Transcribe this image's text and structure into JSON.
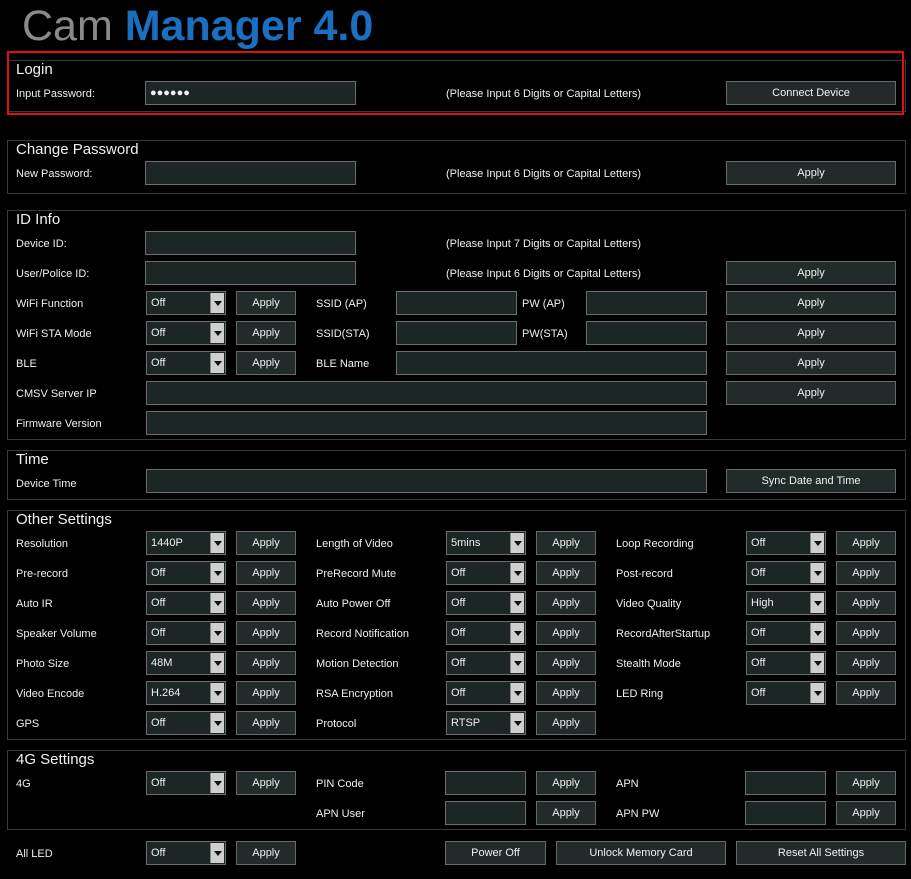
{
  "app": {
    "title_part1": "Cam ",
    "title_part2": "Manager 4.0"
  },
  "login": {
    "title": "Login",
    "password_label": "Input Password:",
    "password_value": "●●●●●●",
    "hint": "(Please Input 6 Digits or Capital Letters)",
    "connect_label": "Connect Device"
  },
  "change_password": {
    "title": "Change Password",
    "new_label": "New Password:",
    "hint": "(Please Input 6 Digits or Capital Letters)",
    "apply": "Apply"
  },
  "id_info": {
    "title": "ID Info",
    "device_id_label": "Device ID:",
    "device_id_hint": "(Please Input 7 Digits or Capital Letters)",
    "user_id_label": "User/Police ID:",
    "user_id_hint": "(Please Input 6 Digits or Capital Letters)",
    "wifi_function_label": "WiFi Function",
    "wifi_function_value": "Off",
    "ssid_ap_label": "SSID (AP)",
    "pw_ap_label": "PW (AP)",
    "wifi_sta_label": "WiFi STA Mode",
    "wifi_sta_value": "Off",
    "ssid_sta_label": "SSID(STA)",
    "pw_sta_label": "PW(STA)",
    "ble_label": "BLE",
    "ble_value": "Off",
    "ble_name_label": "BLE Name",
    "cmsv_label": "CMSV Server IP",
    "firmware_label": "Firmware Version",
    "apply": "Apply"
  },
  "time": {
    "title": "Time",
    "device_time_label": "Device Time",
    "sync_label": "Sync Date and Time"
  },
  "other": {
    "title": "Other Settings",
    "apply": "Apply",
    "rows": [
      {
        "l1": "Resolution",
        "v1": "1440P",
        "l2": "Length of Video",
        "v2": "5mins",
        "l3": "Loop Recording",
        "v3": "Off"
      },
      {
        "l1": "Pre-record",
        "v1": "Off",
        "l2": "PreRecord Mute",
        "v2": "Off",
        "l3": "Post-record",
        "v3": "Off"
      },
      {
        "l1": "Auto IR",
        "v1": "Off",
        "l2": "Auto Power Off",
        "v2": "Off",
        "l3": "Video Quality",
        "v3": "High"
      },
      {
        "l1": "Speaker Volume",
        "v1": "Off",
        "l2": "Record Notification",
        "v2": "Off",
        "l3": "RecordAfterStartup",
        "v3": "Off"
      },
      {
        "l1": "Photo Size",
        "v1": "48M",
        "l2": "Motion Detection",
        "v2": "Off",
        "l3": "Stealth Mode",
        "v3": "Off"
      },
      {
        "l1": "Video Encode",
        "v1": "H.264",
        "l2": "RSA Encryption",
        "v2": "Off",
        "l3": "LED Ring",
        "v3": "Off"
      },
      {
        "l1": "GPS",
        "v1": "Off",
        "l2": "Protocol",
        "v2": "RTSP"
      }
    ]
  },
  "g4": {
    "title": "4G Settings",
    "g4_label": "4G",
    "g4_value": "Off",
    "pin_label": "PIN Code",
    "apn_label": "APN",
    "apn_user_label": "APN User",
    "apn_pw_label": "APN PW",
    "apply": "Apply"
  },
  "bottom": {
    "all_led_label": "All LED",
    "all_led_value": "Off",
    "apply": "Apply",
    "power_off": "Power Off",
    "unlock": "Unlock Memory Card",
    "reset": "Reset All Settings"
  }
}
